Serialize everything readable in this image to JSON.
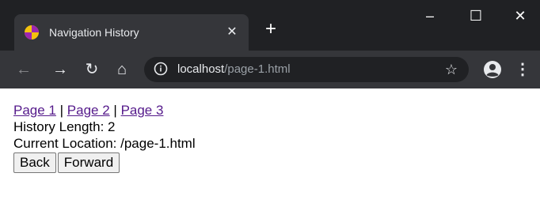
{
  "browser": {
    "tab_title": "Navigation History",
    "tab_close_glyph": "✕",
    "new_tab_glyph": "+",
    "window_controls": {
      "minimize": "–",
      "maximize": "☐",
      "close": "✕"
    },
    "nav": {
      "back": "←",
      "forward": "→",
      "reload": "↻",
      "home": "⌂"
    },
    "omnibox": {
      "host": "localhost",
      "path": "/page-1.html"
    },
    "bookmark_glyph": "☆",
    "menu_glyph": "⋮",
    "icons": [
      "favicon-icon",
      "info-icon",
      "star-icon",
      "profile-icon",
      "menu-icon"
    ],
    "colors": {
      "titlebar": "#202124",
      "toolbar": "#35363a",
      "link": "#551a8b"
    }
  },
  "page": {
    "links": [
      {
        "label": "Page 1"
      },
      {
        "label": "Page 2"
      },
      {
        "label": "Page 3"
      }
    ],
    "separator": "|",
    "history_length_text": "History Length: 2",
    "current_location_text": "Current Location: /page-1.html",
    "buttons": {
      "back": "Back",
      "forward": "Forward"
    }
  }
}
